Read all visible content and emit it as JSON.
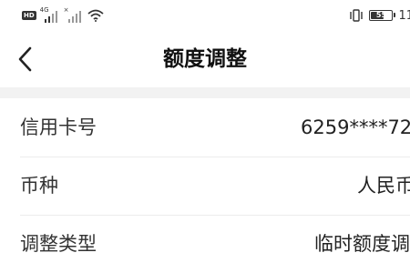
{
  "status_bar": {
    "hd_badge": "HD",
    "network_1": "4G",
    "network_2": "×",
    "battery_level": "55",
    "battery_fraction": 0.55,
    "time": "11"
  },
  "nav": {
    "back_icon": "chevron-left-icon",
    "title": "额度调整"
  },
  "rows": [
    {
      "label": "信用卡号",
      "value": "6259****72"
    },
    {
      "label": "币种",
      "value": "人民币"
    },
    {
      "label": "调整类型",
      "value": "临时额度调"
    }
  ],
  "colors": {
    "background": "#ffffff",
    "divider_band": "#f2f2f2",
    "text_primary": "#222222"
  }
}
